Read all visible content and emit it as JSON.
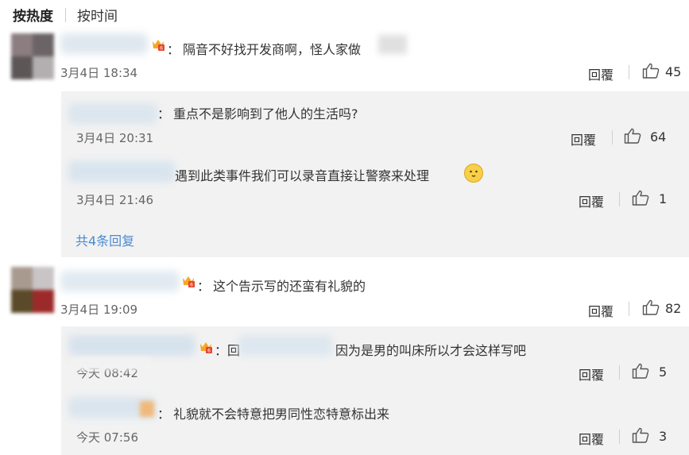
{
  "tabs": {
    "hot": "按热度",
    "time": "按时间"
  },
  "labels": {
    "reply": "回覆"
  },
  "comments": [
    {
      "text": "隔音不好找开发商啊，怪人家做",
      "time": "3月4日 18:34",
      "likes": "45",
      "replies": [
        {
          "text": "重点不是影响到了他人的生活吗?",
          "time": "3月4日 20:31",
          "likes": "64"
        },
        {
          "text": "遇到此类事件我们可以录音直接让警察来处理",
          "time": "3月4日 21:46",
          "likes": "1"
        }
      ],
      "more": "共4条回复"
    },
    {
      "text": "这个告示写的还蛮有礼貌的",
      "time": "3月4日 19:09",
      "likes": "82",
      "replies": [
        {
          "prefix": "回",
          "text": "因为是男的叫床所以才会这样写吧",
          "time": "今天 08:42",
          "likes": "5"
        },
        {
          "text": "礼貌就不会特意把男同性恋特意标出来",
          "time": "今天 07:56",
          "likes": "3"
        }
      ]
    }
  ]
}
